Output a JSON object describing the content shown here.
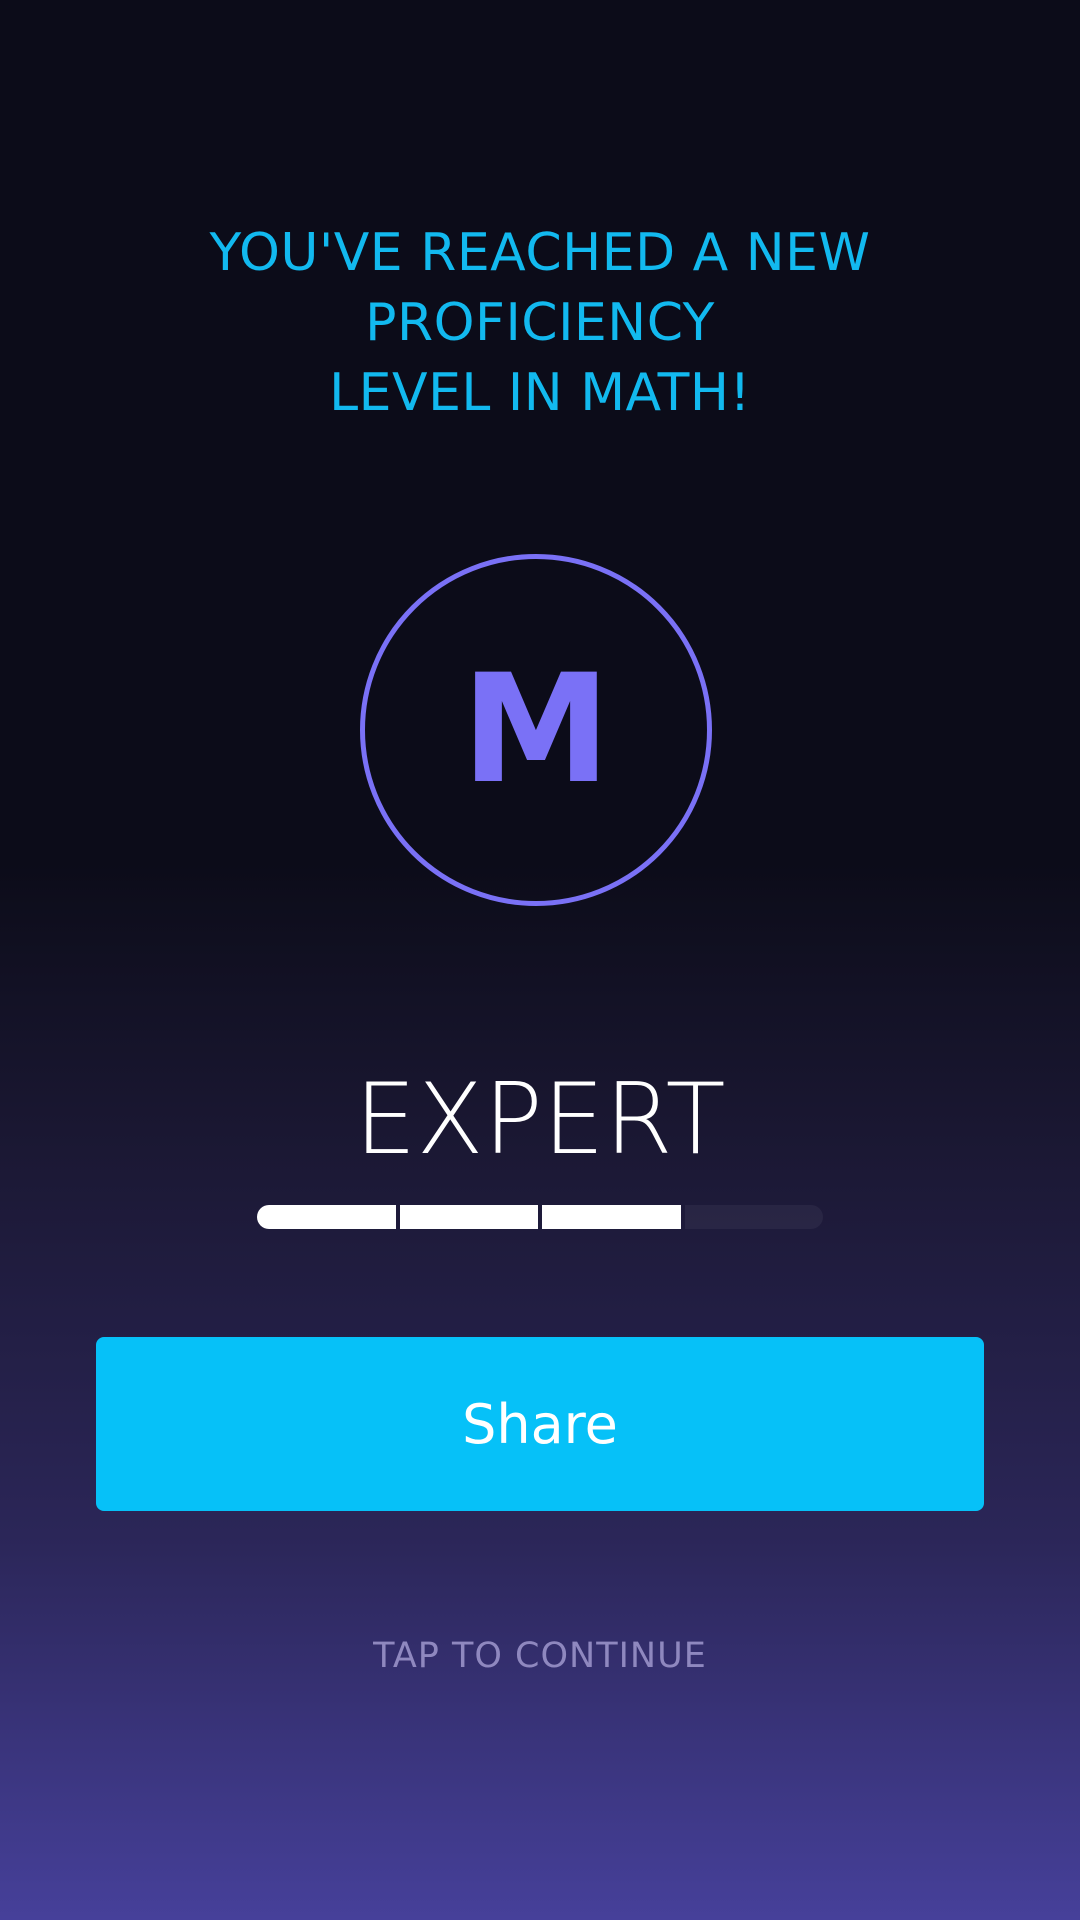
{
  "headline": {
    "line1": "YOU'VE REACHED A NEW PROFICIENCY",
    "line2": "LEVEL IN MATH!"
  },
  "badge": {
    "letter": "M",
    "icon": "math-badge-icon",
    "color": "#7a71f6"
  },
  "level": {
    "name": "EXPERT",
    "progress_segments_total": 4,
    "progress_segments_filled": 3
  },
  "actions": {
    "share_label": "Share",
    "continue_label": "TAP TO CONTINUE"
  },
  "colors": {
    "accent": "#06c1f8",
    "headline": "#12b9ef",
    "badge": "#7a71f6",
    "continue_text": "#8f88bf"
  }
}
